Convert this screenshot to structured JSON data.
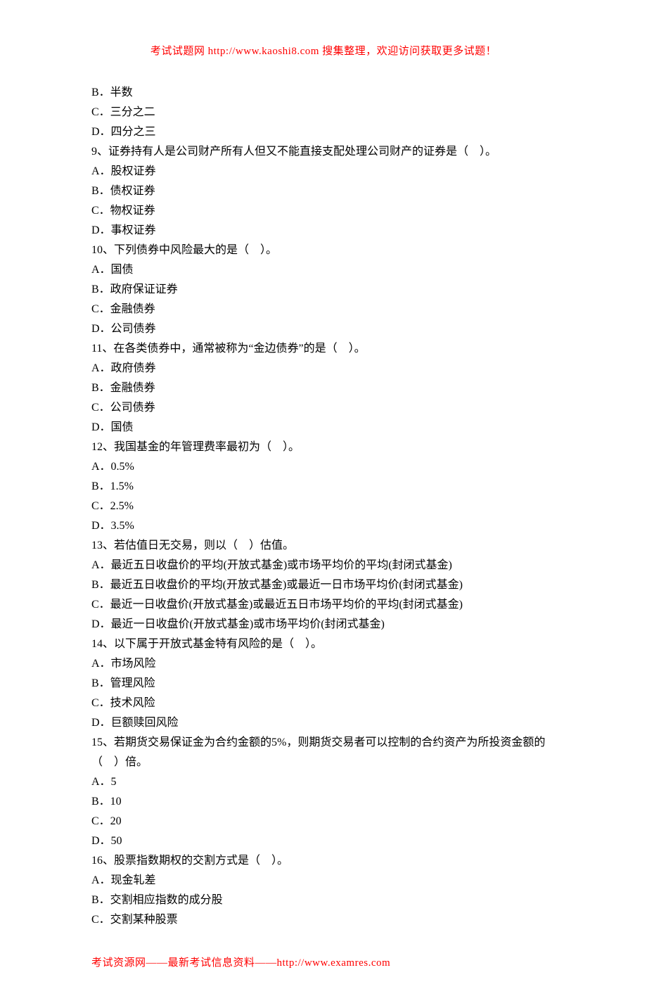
{
  "header": {
    "text": "考试试题网 http://www.kaoshi8.com 搜集整理，欢迎访问获取更多试题！"
  },
  "lines": [
    "B．半数",
    "C．三分之二",
    "D．四分之三",
    "9、证券持有人是公司财产所有人但又不能直接支配处理公司财产的证券是（　）。",
    "A．股权证券",
    "B．债权证券",
    "C．物权证券",
    "D．事权证券",
    "10、下列债券中风险最大的是（　）。",
    "A．国债",
    "B．政府保证证券",
    "C．金融债券",
    "D．公司债券",
    "11、在各类债券中，通常被称为“金边债券”的是（　）。",
    "A．政府债券",
    "B．金融债券",
    "C．公司债券",
    "D．国债",
    "12、我国基金的年管理费率最初为（　）。",
    "A．0.5%",
    "B．1.5%",
    "C．2.5%",
    "D．3.5%",
    "13、若估值日无交易，则以（　）估值。",
    "A．最近五日收盘价的平均(开放式基金)或市场平均价的平均(封闭式基金)",
    "B．最近五日收盘价的平均(开放式基金)或最近一日市场平均价(封闭式基金)",
    "C．最近一日收盘价(开放式基金)或最近五日市场平均价的平均(封闭式基金)",
    "D．最近一日收盘价(开放式基金)或市场平均价(封闭式基金)",
    "14、以下属于开放式基金特有风险的是（　）。",
    "A．市场风险",
    "B．管理风险",
    "C．技术风险",
    "D．巨额赎回风险",
    "15、若期货交易保证金为合约金额的5%，则期货交易者可以控制的合约资产为所投资金额的（　）倍。",
    "A．5",
    "B．10",
    "C．20",
    "D．50",
    "16、股票指数期权的交割方式是（　）。",
    "A．现金轧差",
    "B．交割相应指数的成分股",
    "C．交割某种股票"
  ],
  "footer": {
    "text": "考试资源网——最新考试信息资料——http://www.examres.com"
  }
}
